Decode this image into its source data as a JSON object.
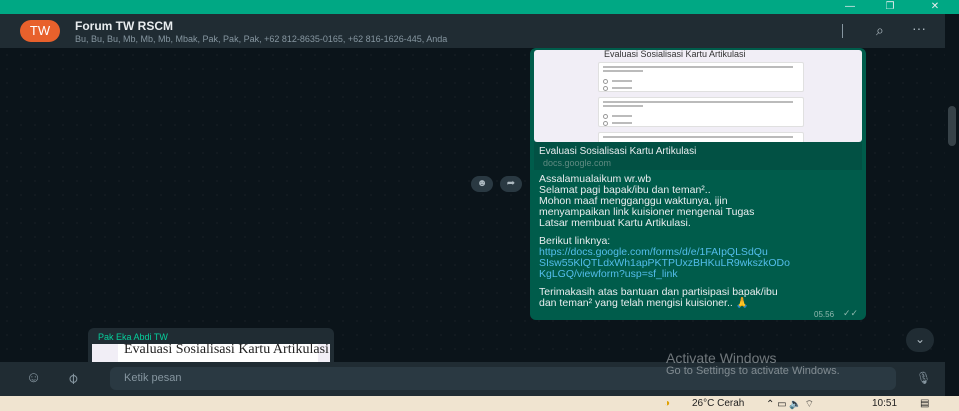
{
  "window": {
    "minimize": "—",
    "restore": "❐",
    "close": "✕"
  },
  "header": {
    "avatar_text": "TW",
    "title": "Forum TW RSCM",
    "subtitle": "Bu, Bu, Bu, Mb, Mb, Mb, Mbak, Pak, Pak, Pak, +62 812-8635-0165, +62 816-1626-445, Anda",
    "search_icon": "⌕",
    "menu_icon": "···"
  },
  "message_out": {
    "preview_form_title": "Evaluasi Sosialisasi Kartu Artikulasi",
    "link_title": "Evaluasi Sosialisasi Kartu Artikulasi",
    "link_domain": "docs.google.com",
    "lines": [
      "Assalamualaikum wr.wb",
      "Selamat pagi bapak/ibu dan teman².. ",
      "Mohon maaf mengganggu waktunya, ijin",
      "menyampaikan link kuisioner mengenai Tugas",
      "Latsar membuat Kartu Artikulasi."
    ],
    "intro_link": "Berikut linknya:",
    "url_lines": [
      "https://docs.google.com/forms/d/e/1FAIpQLSdQu",
      "SIsw55KlQTLdxWh1apPKTPUxzBHKuLR9wkszkODo",
      "KgLGQ/viewform?usp=sf_link"
    ],
    "closing_lines": [
      "Terimakasih atas bantuan dan partisipasi bapak/ibu",
      "dan teman² yang telah mengisi kuisioner.. 🙏"
    ],
    "time": "05.56",
    "ticks": "✓✓"
  },
  "reactions": {
    "emoji_icon": "☻",
    "forward_icon": "➦"
  },
  "message_in": {
    "sender": "Pak Eka Abdi TW",
    "preview_title": "Evaluasi Sosialisasi Kartu Artikulasi"
  },
  "scroll_down_icon": "⌄",
  "footer": {
    "emoji_icon": "☺",
    "attach_icon": "⌀",
    "placeholder": "Ketik pesan",
    "mic_icon": "🎙"
  },
  "watermark": {
    "line1": "Activate Windows",
    "line2": "Go to Settings to activate Windows."
  },
  "taskbar": {
    "weather": "26°C  Cerah",
    "tray": "⌃  ▭  🔈  ⌔",
    "clock": "10:51",
    "notify_icon": "▤"
  }
}
